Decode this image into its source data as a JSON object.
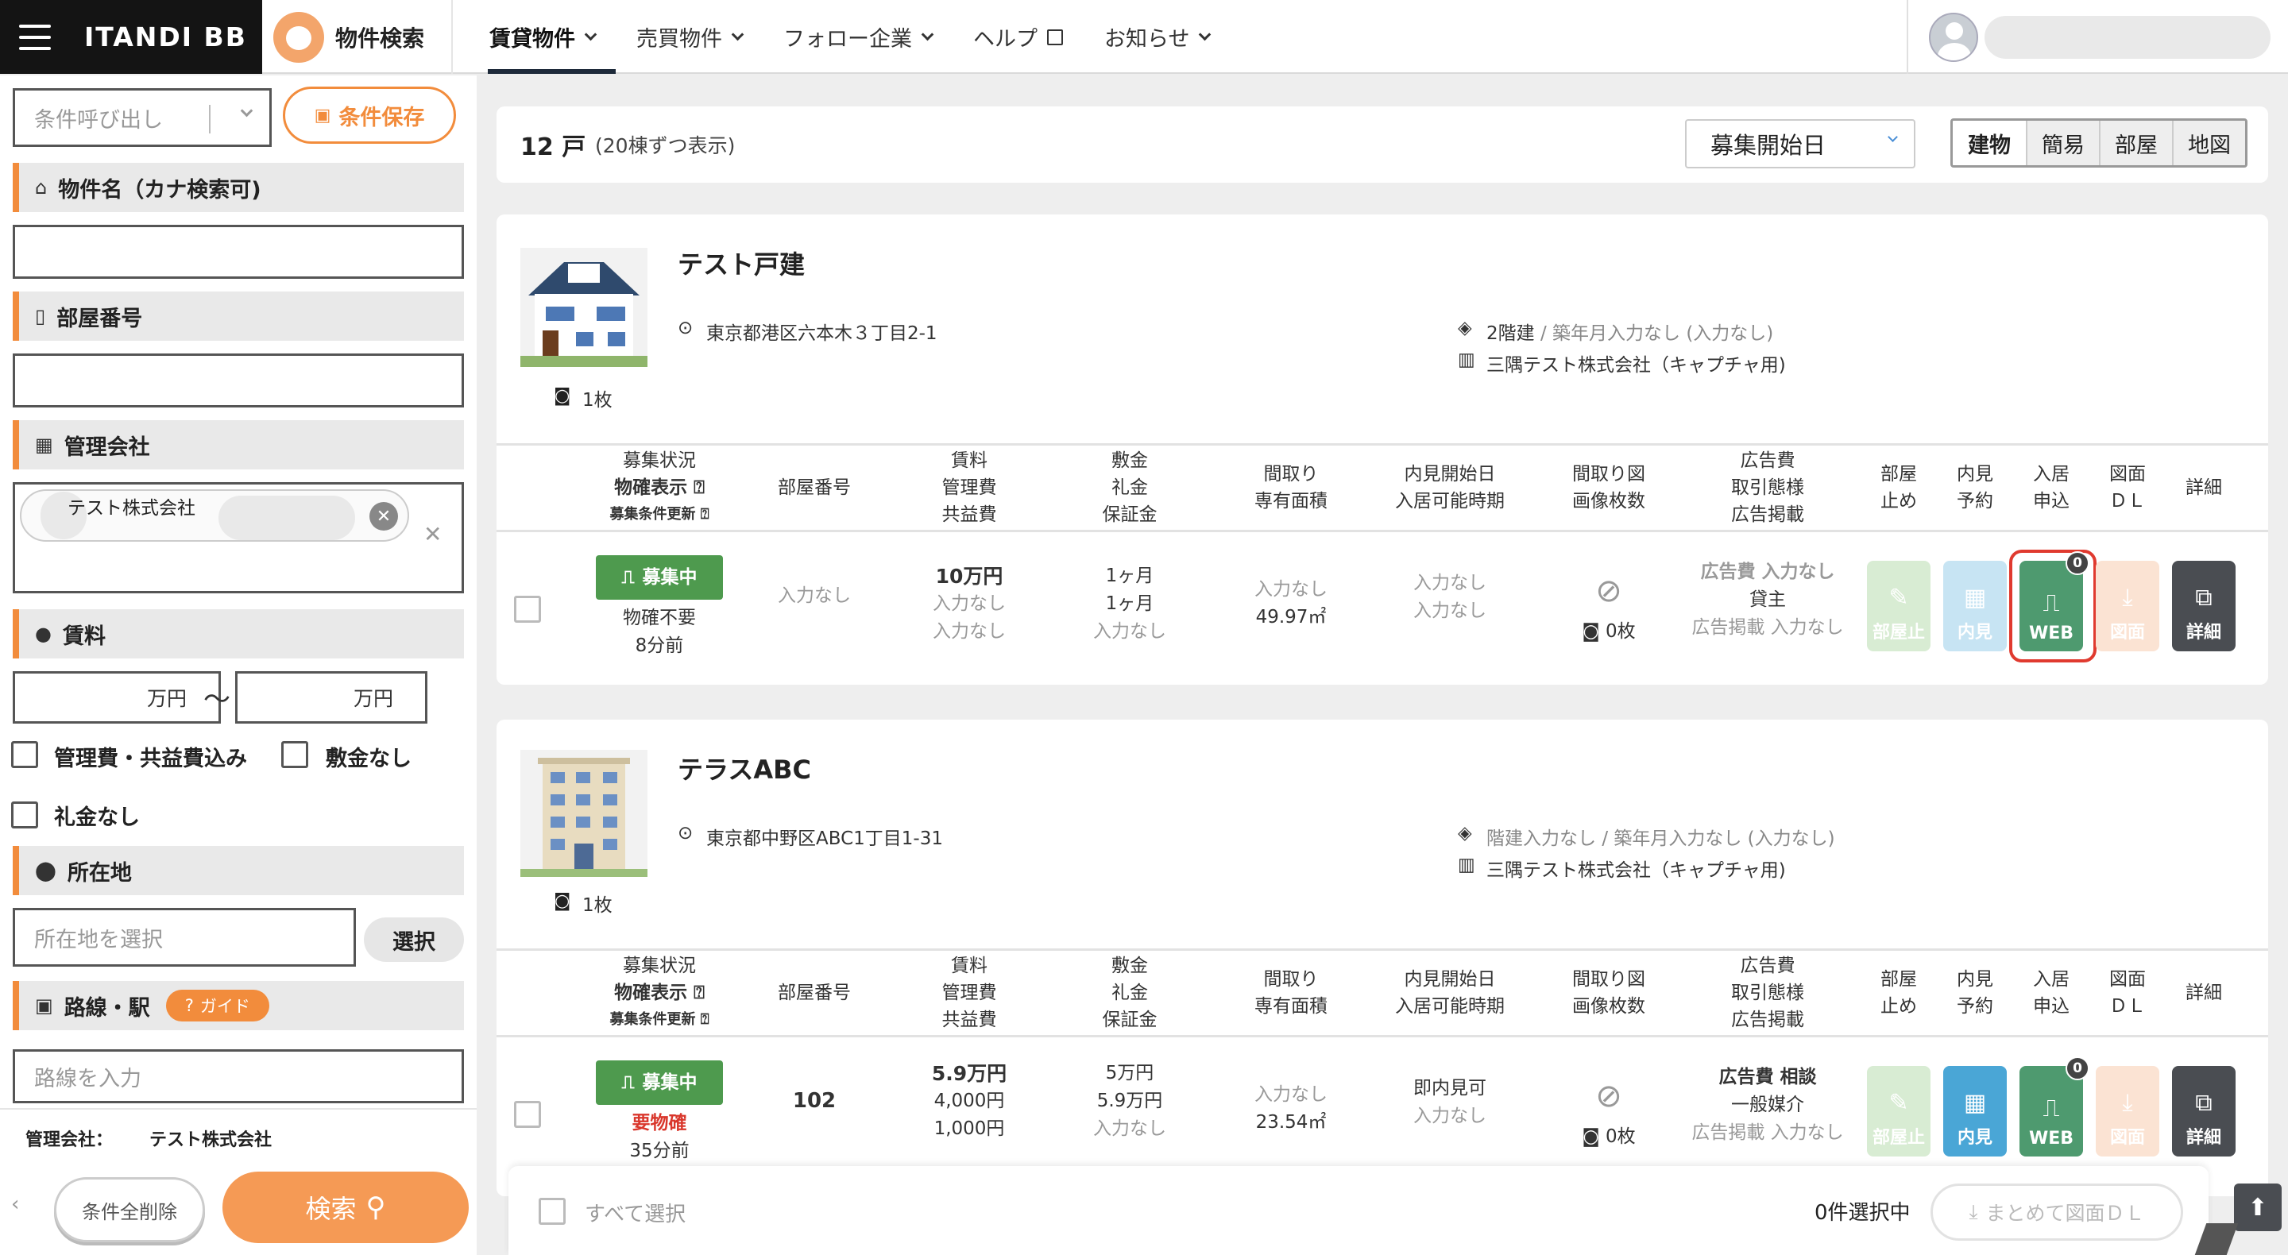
{
  "header": {
    "brand": "ITANDI BB",
    "product": "物件検索",
    "nav": [
      {
        "label": "賃貸物件",
        "active": true
      },
      {
        "label": "売買物件"
      },
      {
        "label": "フォロー企業"
      },
      {
        "label": "ヘルプ"
      },
      {
        "label": "お知らせ"
      }
    ]
  },
  "sidebar": {
    "recall_placeholder": "条件呼び出し",
    "save_label": "条件保存",
    "name_section": "物件名（カナ検索可)",
    "room_section": "部屋番号",
    "company_section": "管理会社",
    "company_tag": "テスト株式会社",
    "rent_section": "賃料",
    "rent_unit_min": "万円",
    "rent_range_sep": "〜",
    "rent_unit_max": "万円",
    "opt_mgmt": "管理費・共益費込み",
    "opt_no_deposit": "敷金なし",
    "opt_no_key": "礼金なし",
    "location_section": "所在地",
    "location_placeholder": "所在地を選択",
    "select_label": "選択",
    "line_section": "路線・駅",
    "guide_label": "ガイド",
    "line_placeholder": "路線を入力",
    "summary_label": "管理会社：",
    "summary_value": "テスト株式会社",
    "clear_label": "条件全削除",
    "search_label": "検索"
  },
  "results": {
    "count": "12 戸",
    "per_page": "(20棟ずつ表示)",
    "sort_value": "募集開始日",
    "view_tabs": [
      "建物",
      "簡易",
      "部屋",
      "地図"
    ]
  },
  "table_headers": {
    "status": [
      "募集状況",
      "物確表示",
      "募集条件更新"
    ],
    "room": "部屋番号",
    "rent": [
      "賃料",
      "管理費",
      "共益費"
    ],
    "deposit": [
      "敷金",
      "礼金",
      "保証金"
    ],
    "layout": [
      "間取り",
      "専有面積"
    ],
    "viewing": [
      "内見開始日",
      "入居可能時期"
    ],
    "floorplan": [
      "間取り図",
      "画像枚数"
    ],
    "ad": [
      "広告費",
      "取引態様",
      "広告掲載"
    ],
    "actions": [
      [
        "部屋",
        "止め"
      ],
      [
        "内見",
        "予約"
      ],
      [
        "入居",
        "申込"
      ],
      [
        "図面",
        "ＤＬ"
      ],
      [
        "詳細"
      ]
    ]
  },
  "properties": [
    {
      "name": "テスト戸建",
      "address": "東京都港区六本木３丁目2-1",
      "photos": "1枚",
      "structure": "2階建",
      "built": "/ 築年月入力なし (入力なし)",
      "company": "三隅テスト株式会社（キャプチャ用)",
      "room": {
        "status": "募集中",
        "confirm": "物確不要",
        "updated": "8分前",
        "room_no": "入力なし",
        "rent": "10万円",
        "mgmt": "入力なし",
        "common": "入力なし",
        "deposit": "1ヶ月",
        "key": "1ヶ月",
        "guarantee": "入力なし",
        "layout": "入力なし",
        "area": "49.97㎡",
        "view_start": "入力なし",
        "move_in": "入力なし",
        "images": "0枚",
        "ad_fee": "広告費 入力なし",
        "trade": "貸主",
        "ad_post": "広告掲載 入力なし",
        "apply_count": "0"
      }
    },
    {
      "name": "テラスABC",
      "address": "東京都中野区ABC1丁目1-31",
      "photos": "1枚",
      "structure": "階建入力なし",
      "built": "/ 築年月入力なし (入力なし)",
      "company": "三隅テスト株式会社（キャプチャ用)",
      "room": {
        "status": "募集中",
        "confirm": "要物確",
        "updated": "35分前",
        "room_no": "102",
        "rent": "5.9万円",
        "mgmt": "4,000円",
        "common": "1,000円",
        "deposit": "5万円",
        "key": "5.9万円",
        "guarantee": "入力なし",
        "layout": "入力なし",
        "area": "23.54㎡",
        "view_start": "即内見可",
        "move_in": "入力なし",
        "images": "0枚",
        "ad_fee": "広告費 相談",
        "trade": "一般媒介",
        "ad_post": "広告掲載 入力なし",
        "apply_count": "0"
      }
    }
  ],
  "action_labels": {
    "stop": "部屋止",
    "view": "内見",
    "web": "WEB",
    "dl": "図面",
    "detail": "詳細"
  },
  "footer_bar": {
    "select_all": "すべて選択",
    "selected": "0件選択中",
    "bulk_dl": "まとめて図面ＤＬ"
  },
  "colors": {
    "accent": "#f28c3c",
    "status_green": "#4e9a4e",
    "web_green": "#4e9a6f",
    "view_blue": "#4aa6d6",
    "highlight_red": "#e03a2f"
  }
}
